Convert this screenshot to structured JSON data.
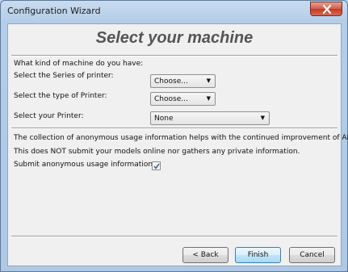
{
  "window": {
    "title": "Configuration Wizard",
    "close_icon": "close-icon"
  },
  "heading": "Select your machine",
  "form": {
    "question": "What kind of machine do you have:",
    "series_label": "Select the Series of printer:",
    "series_value": "Choose...",
    "type_label": "Select the type of Printer:",
    "type_value": "Choose...",
    "printer_label": "Select your Printer:",
    "printer_value": "None"
  },
  "usage": {
    "line1": "The collection of anonymous usage information helps with the continued improvement of APEX.",
    "line2": "This does NOT submit your models online nor gathers any private information.",
    "submit_label": "Submit anonymous usage information:",
    "submit_checked": true
  },
  "buttons": {
    "back": "< Back",
    "finish": "Finish",
    "cancel": "Cancel"
  },
  "colors": {
    "close_button": "#c23a21",
    "default_button_border": "#3c7fb1",
    "heading_text": "#555555"
  }
}
